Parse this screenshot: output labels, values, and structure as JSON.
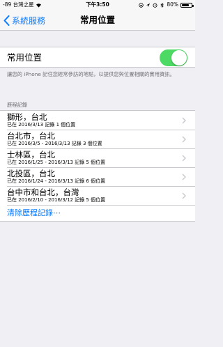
{
  "status_bar": {
    "signal": "-89",
    "carrier": "台灣之星",
    "time": "下午3:50",
    "battery": "80%",
    "battery_level": 0.8
  },
  "nav": {
    "back_label": "系統服務",
    "title": "常用位置"
  },
  "toggle": {
    "label": "常用位置",
    "on": true,
    "color": "#4cd964"
  },
  "footer_note": "讓您的 iPhone 記住您經常參訪的地點，以提供您與位置相關的實用資訊。",
  "history": {
    "header": "歷程記錄",
    "items": [
      {
        "title": "獅形，台北",
        "subtitle": "已在 2016/3/13 記錄 1 個位置"
      },
      {
        "title": "台北市，台北",
        "subtitle": "已在 2016/3/5 - 2016/3/13 記錄 3 個位置"
      },
      {
        "title": "士林區，台北",
        "subtitle": "已在 2016/1/25 - 2016/3/13 記錄 5 個位置"
      },
      {
        "title": "北投區，台北",
        "subtitle": "已在 2016/1/24 - 2016/3/13 記錄 6 個位置"
      },
      {
        "title": "台中市和台北，台灣",
        "subtitle": "已在 2016/2/10 - 2016/3/12 記錄 5 個位置"
      }
    ],
    "clear_label": "清除歷程記錄⋯"
  },
  "accent_color": "#0a7aff"
}
